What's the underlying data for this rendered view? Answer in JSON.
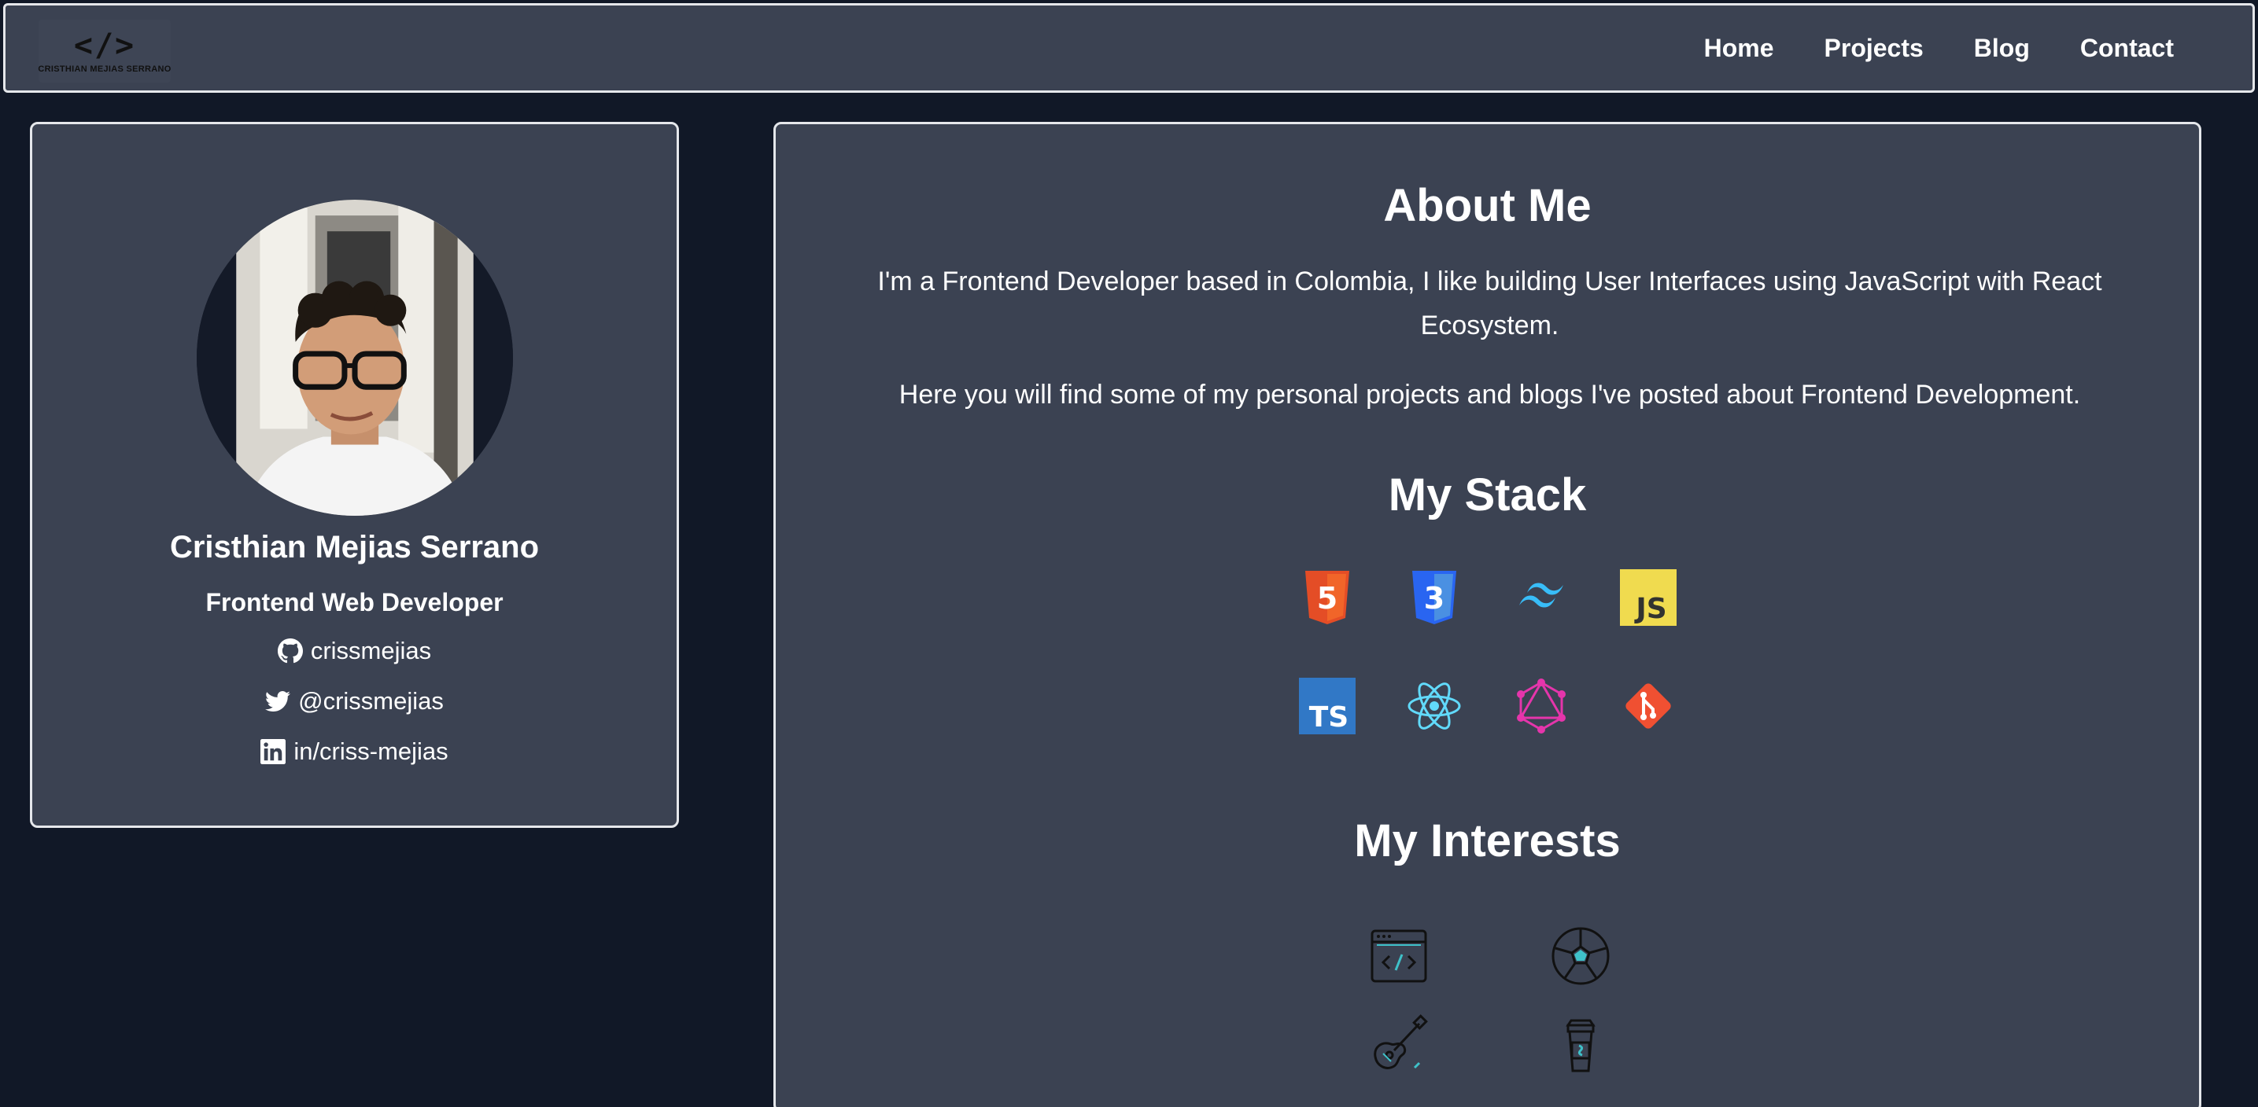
{
  "logo": {
    "mark": "</>",
    "subtitle": "CRISTHIAN MEJIAS SERRANO"
  },
  "nav": {
    "items": [
      "Home",
      "Projects",
      "Blog",
      "Contact"
    ]
  },
  "profile": {
    "name": "Cristhian Mejias Serrano",
    "role": "Frontend Web Developer",
    "github": "crissmejias",
    "twitter": "@crissmejias",
    "linkedin": "in/criss-mejias"
  },
  "about": {
    "heading": "About Me",
    "paragraph1": "I'm a Frontend Developer based in Colombia, I like building User Interfaces using JavaScript with React Ecosystem.",
    "paragraph2": "Here you will find some of my personal projects and blogs I've posted about Frontend Development."
  },
  "stack": {
    "heading": "My Stack",
    "icons": [
      "html5-icon",
      "css3-icon",
      "tailwind-icon",
      "javascript-icon",
      "typescript-icon",
      "react-icon",
      "graphql-icon",
      "git-icon"
    ],
    "js_label": "JS",
    "ts_label": "TS",
    "html_label": "5",
    "css_label": "3"
  },
  "interests": {
    "heading": "My Interests",
    "icons": [
      "code-window-icon",
      "soccer-ball-icon",
      "guitar-icon",
      "coffee-cup-icon"
    ]
  },
  "colors": {
    "background": "#111827",
    "card": "#3b4252",
    "border": "#e5e7eb",
    "html": "#e44d26",
    "css": "#2965f1",
    "tailwind": "#38bdf8",
    "js": "#f0db4f",
    "ts": "#3178c6",
    "react": "#61dafb",
    "graphql": "#e535ab",
    "git": "#f05032",
    "interest_accent": "#3fc1c9"
  }
}
